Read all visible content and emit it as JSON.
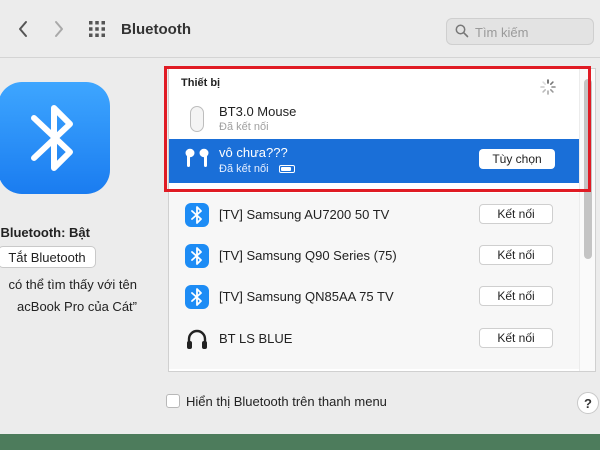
{
  "toolbar": {
    "title": "Bluetooth",
    "search_placeholder": "Tìm kiếm"
  },
  "left_pane": {
    "status": "Bluetooth: Bật",
    "toggle_button": "Tắt Bluetooth",
    "discover_line1": "có thể tìm thấy với tên",
    "discover_line2": "acBook Pro của Cát”"
  },
  "devices": {
    "section_title": "Thiết bị",
    "paired": [
      {
        "name": "BT3.0 Mouse",
        "status": "Đã kết nối",
        "icon": "mouse-icon"
      },
      {
        "name": "vô chưa???",
        "status": "Đã kết nối",
        "icon": "airpods-icon",
        "action": "Tùy chọn",
        "selected": true
      }
    ],
    "nearby": [
      {
        "name": "[TV] Samsung AU7200 50 TV",
        "action": "Kết nối",
        "icon": "bluetooth-icon"
      },
      {
        "name": "[TV] Samsung Q90 Series (75)",
        "action": "Kết nối",
        "icon": "bluetooth-icon"
      },
      {
        "name": "[TV] Samsung QN85AA 75 TV",
        "action": "Kết nối",
        "icon": "bluetooth-icon"
      },
      {
        "name": "BT LS BLUE",
        "action": "Kết nối",
        "icon": "headphones-icon"
      }
    ]
  },
  "footer": {
    "show_in_menu_label": "Hiển thị Bluetooth trên thanh menu",
    "show_in_menu_checked": false,
    "help_label": "?"
  },
  "colors": {
    "selection_blue": "#1a6fd8",
    "bluetooth_blue": "#1d8cf5",
    "annotation_red": "#e01b24"
  }
}
